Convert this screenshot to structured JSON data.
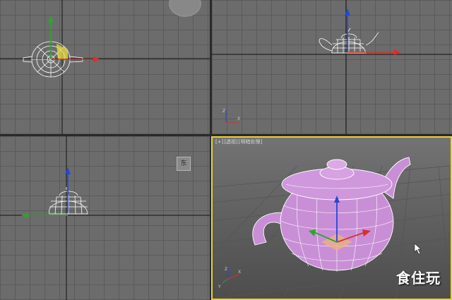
{
  "viewports": {
    "top": {
      "name": "top-left-viewport"
    },
    "front": {
      "name": "top-right-viewport"
    },
    "left": {
      "name": "bottom-left-viewport",
      "cube_label": "东"
    },
    "perspective": {
      "label_plus": "[+]",
      "label_view": "[透视]",
      "label_shading": "[明暗处理]"
    }
  },
  "axis_labels": {
    "z": "Z",
    "x": "X",
    "y": "Y"
  },
  "watermark": "食住玩",
  "colors": {
    "viewport_bg": "#6c6c6c",
    "active_border": "#e6d23a",
    "teapot_fill": "#c98fd6",
    "axis_x": "#d8302a",
    "axis_y": "#2fa32f",
    "axis_z": "#2646d8"
  },
  "icons": [
    "cursor-arrow-icon",
    "axis-tripod-icon",
    "viewcube-icon"
  ]
}
